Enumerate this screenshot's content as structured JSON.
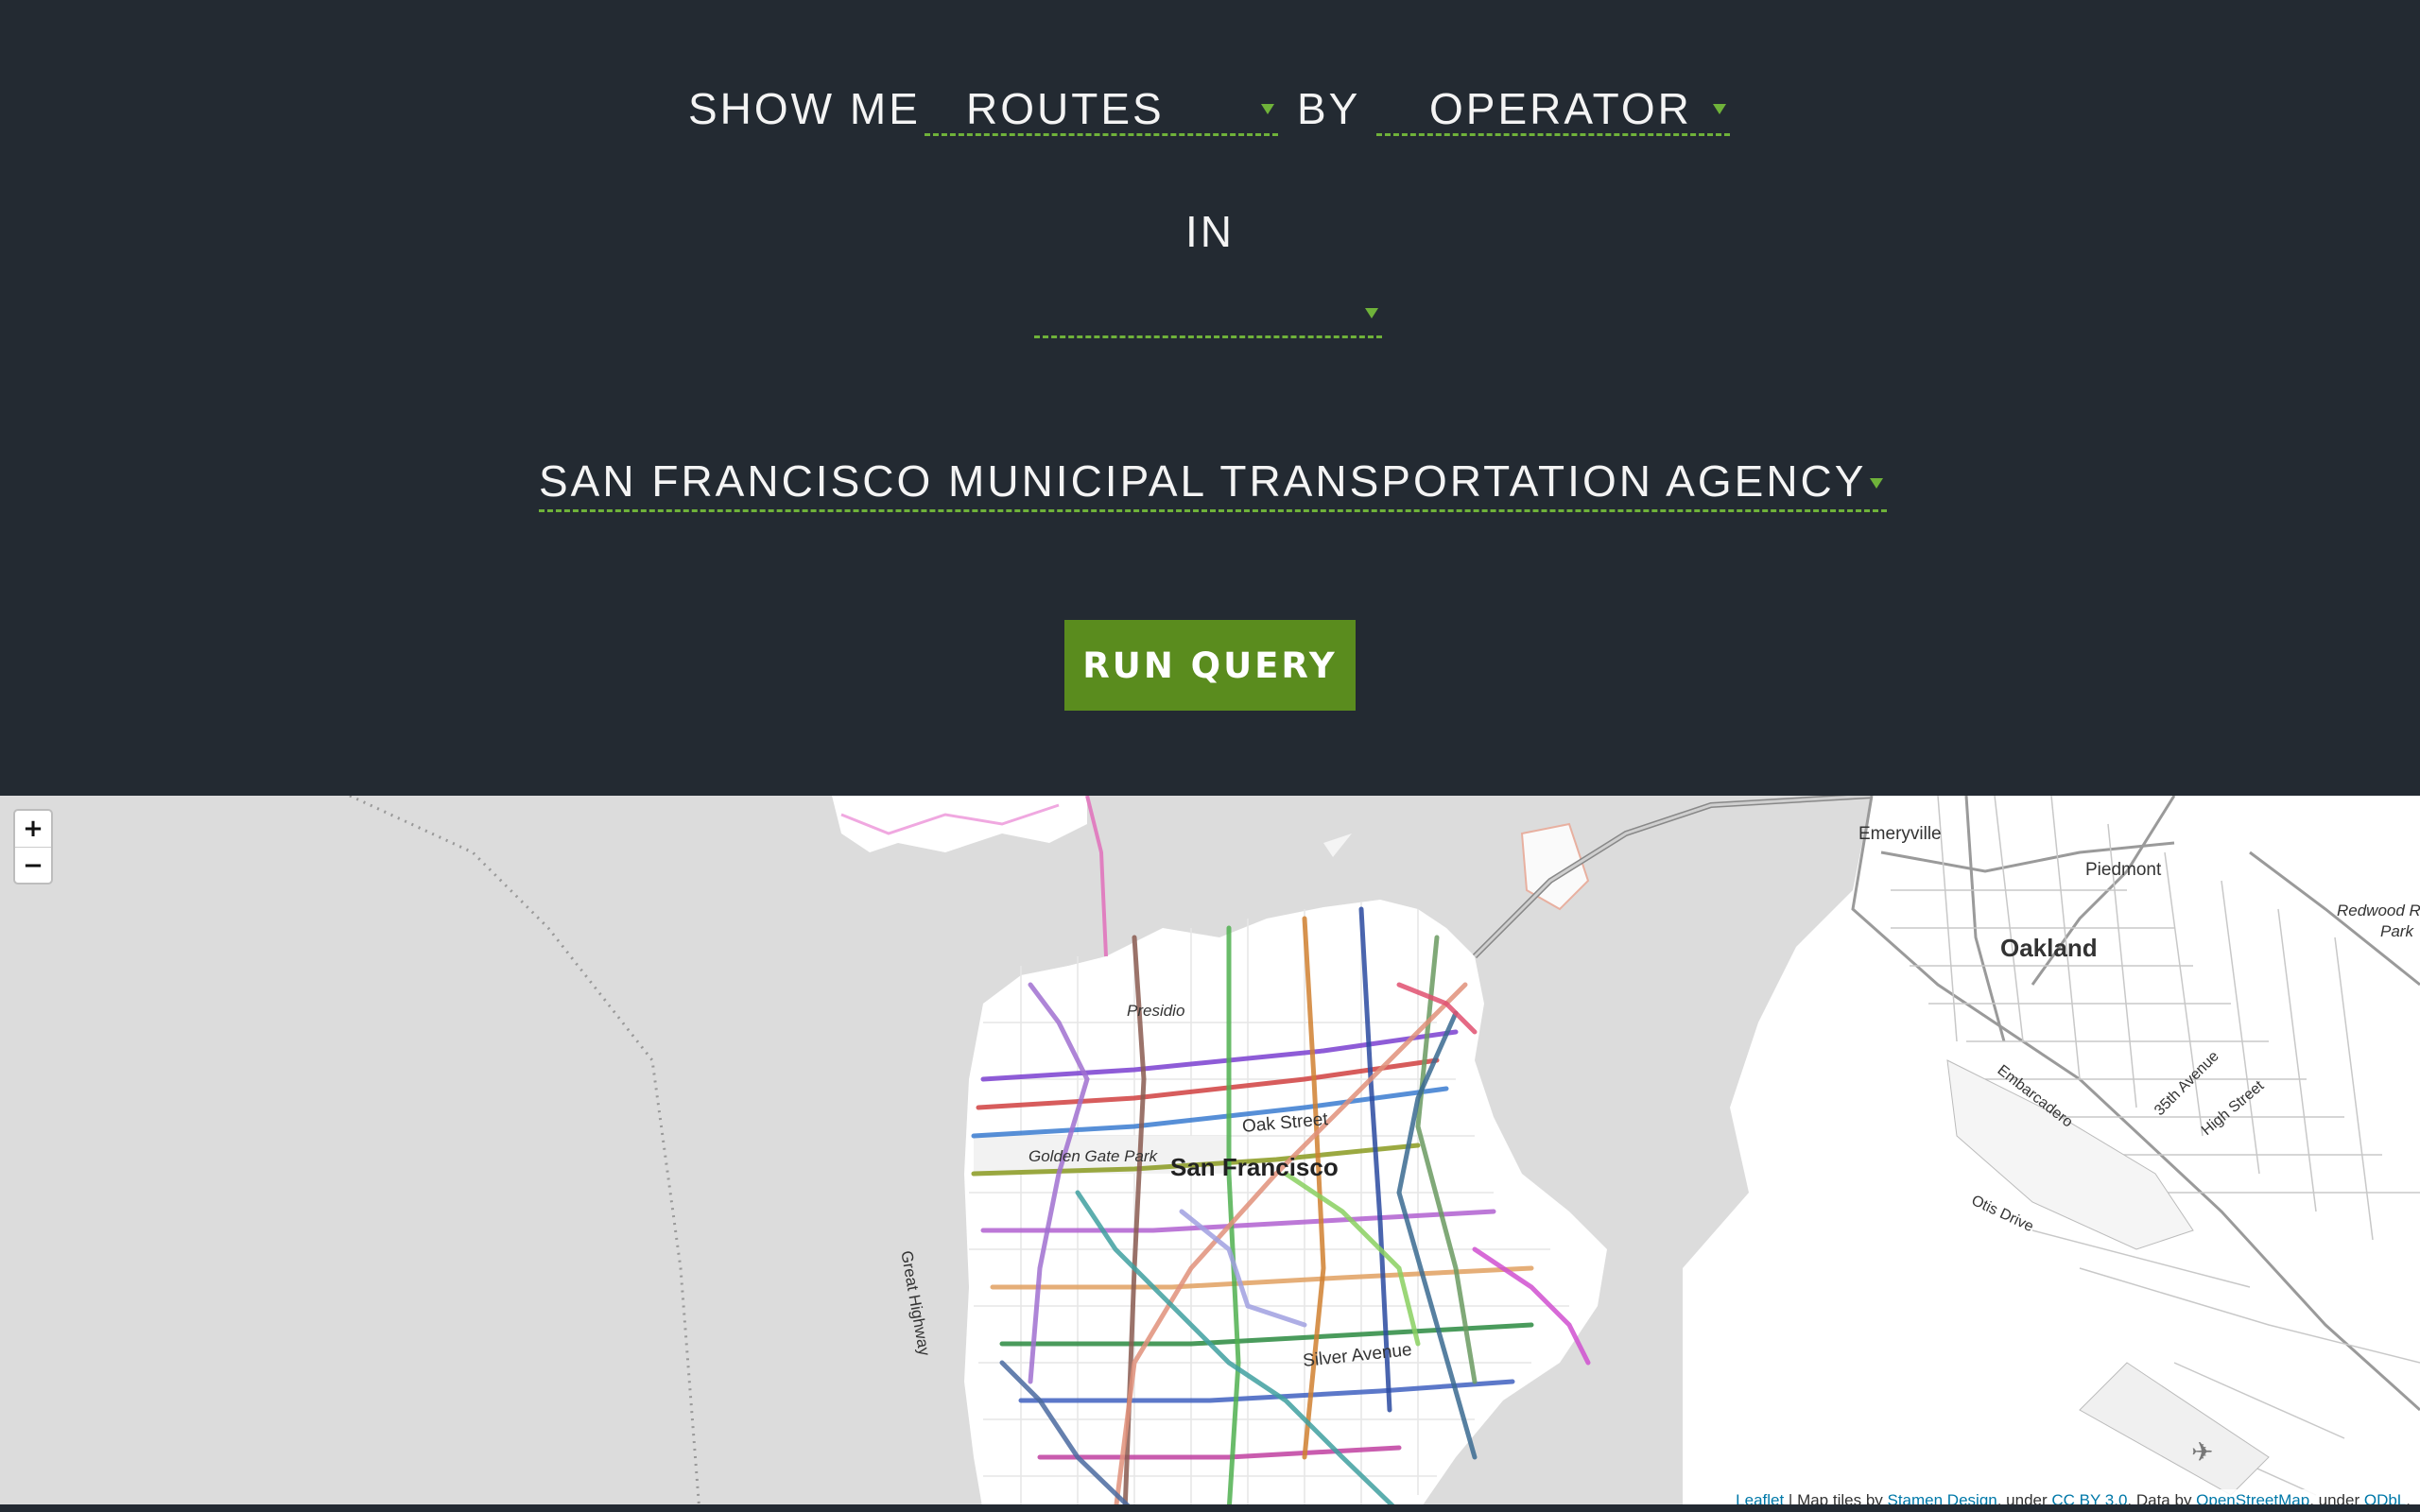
{
  "query": {
    "show_me_label": "SHOW ME",
    "measure_value": "ROUTES",
    "by_label": "BY",
    "grouping_value": "OPERATOR",
    "in_label": "IN",
    "region_value": "",
    "operator_value": "SAN FRANCISCO MUNICIPAL TRANSPORTATION AGENCY",
    "run_button_label": "RUN QUERY"
  },
  "map": {
    "zoom_in_label": "+",
    "zoom_out_label": "−",
    "labels": {
      "emeryville": "Emeryville",
      "piedmont": "Piedmont",
      "oakland": "Oakland",
      "redwood": "Redwood Re",
      "park": "Park",
      "presidio": "Presidio",
      "oak_street": "Oak Street",
      "golden_gate_park": "Golden Gate Park",
      "san_francisco": "San Francisco",
      "great_highway": "Great Highway",
      "silver_avenue": "Silver Avenue",
      "embarcadero": "Embarcadero",
      "35th_avenue": "35th Avenue",
      "high_street": "High Street",
      "otis_drive": "Otis Drive"
    },
    "attribution": {
      "leaflet": "Leaflet",
      "tiles_prefix": " | Map tiles by ",
      "stamen": "Stamen Design",
      "under1": ", under ",
      "ccby": "CC BY 3.0",
      "data_by": ". Data by ",
      "osm": "OpenStreetMap",
      "under2": ", under ",
      "odbl": "ODbL",
      "end": "."
    }
  },
  "colors": {
    "panel_bg": "#232a32",
    "accent_green": "#6fb23a",
    "button_green": "#5a8c1e",
    "water": "#dcdcdc",
    "land": "#ffffff"
  }
}
